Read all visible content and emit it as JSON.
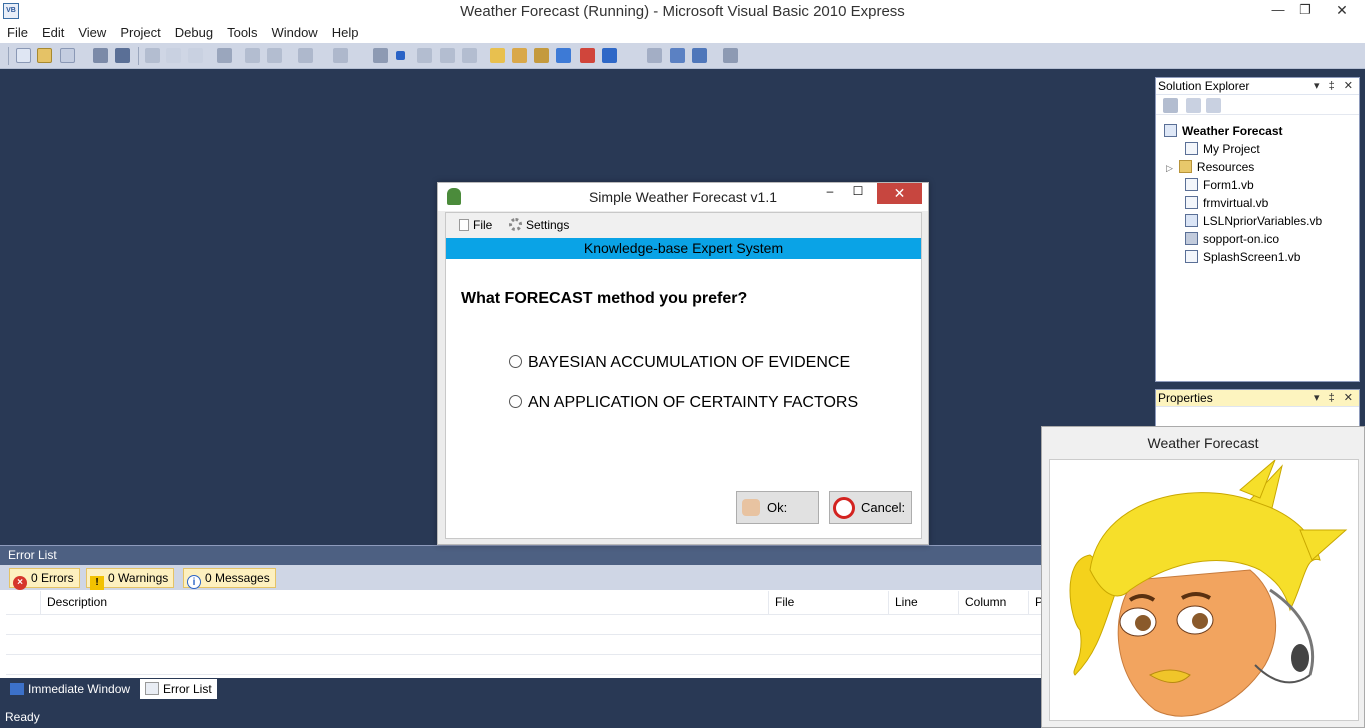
{
  "window": {
    "title": "Weather Forecast (Running) - Microsoft Visual Basic 2010 Express",
    "app_icon_text": "VB",
    "min": "—",
    "restore": "❐",
    "close": "✕"
  },
  "menu": [
    "File",
    "Edit",
    "View",
    "Project",
    "Debug",
    "Tools",
    "Window",
    "Help"
  ],
  "solution_explorer": {
    "title": "Solution Explorer",
    "buttons": "▾ ‡ ✕",
    "root": "Weather Forecast",
    "items": [
      {
        "label": "My Project",
        "icon": "project-icon"
      },
      {
        "label": "Resources",
        "icon": "folder-icon",
        "expander": "▷"
      },
      {
        "label": "Form1.vb",
        "icon": "form-icon"
      },
      {
        "label": "frmvirtual.vb",
        "icon": "form-icon"
      },
      {
        "label": "LSLNpriorVariables.vb",
        "icon": "vb-file-icon"
      },
      {
        "label": "sopport-on.ico",
        "icon": "ico-file-icon"
      },
      {
        "label": "SplashScreen1.vb",
        "icon": "form-icon"
      }
    ]
  },
  "properties": {
    "title": "Properties",
    "buttons": "▾ ‡ ✕"
  },
  "error_list": {
    "title": "Error List",
    "errors": "0 Errors",
    "warnings": "0 Warnings",
    "messages": "0 Messages",
    "columns": [
      "Description",
      "File",
      "Line",
      "Column",
      "P"
    ]
  },
  "bottom_tabs": [
    "Immediate Window",
    "Error List"
  ],
  "status": "Ready",
  "dialog": {
    "title": "Simple Weather Forecast v1.1",
    "menu": [
      "File",
      "Settings"
    ],
    "banner": "Knowledge-base Expert System",
    "question": "What FORECAST method you prefer?",
    "options": [
      "BAYESIAN ACCUMULATION OF EVIDENCE",
      "AN APPLICATION OF CERTAINTY FACTORS"
    ],
    "ok": "Ok:",
    "cancel": "Cancel:",
    "close": "✕",
    "max": "☐",
    "min": "–",
    "banner_color": "#0aa3e6"
  },
  "agent": {
    "title": "Weather Forecast"
  }
}
